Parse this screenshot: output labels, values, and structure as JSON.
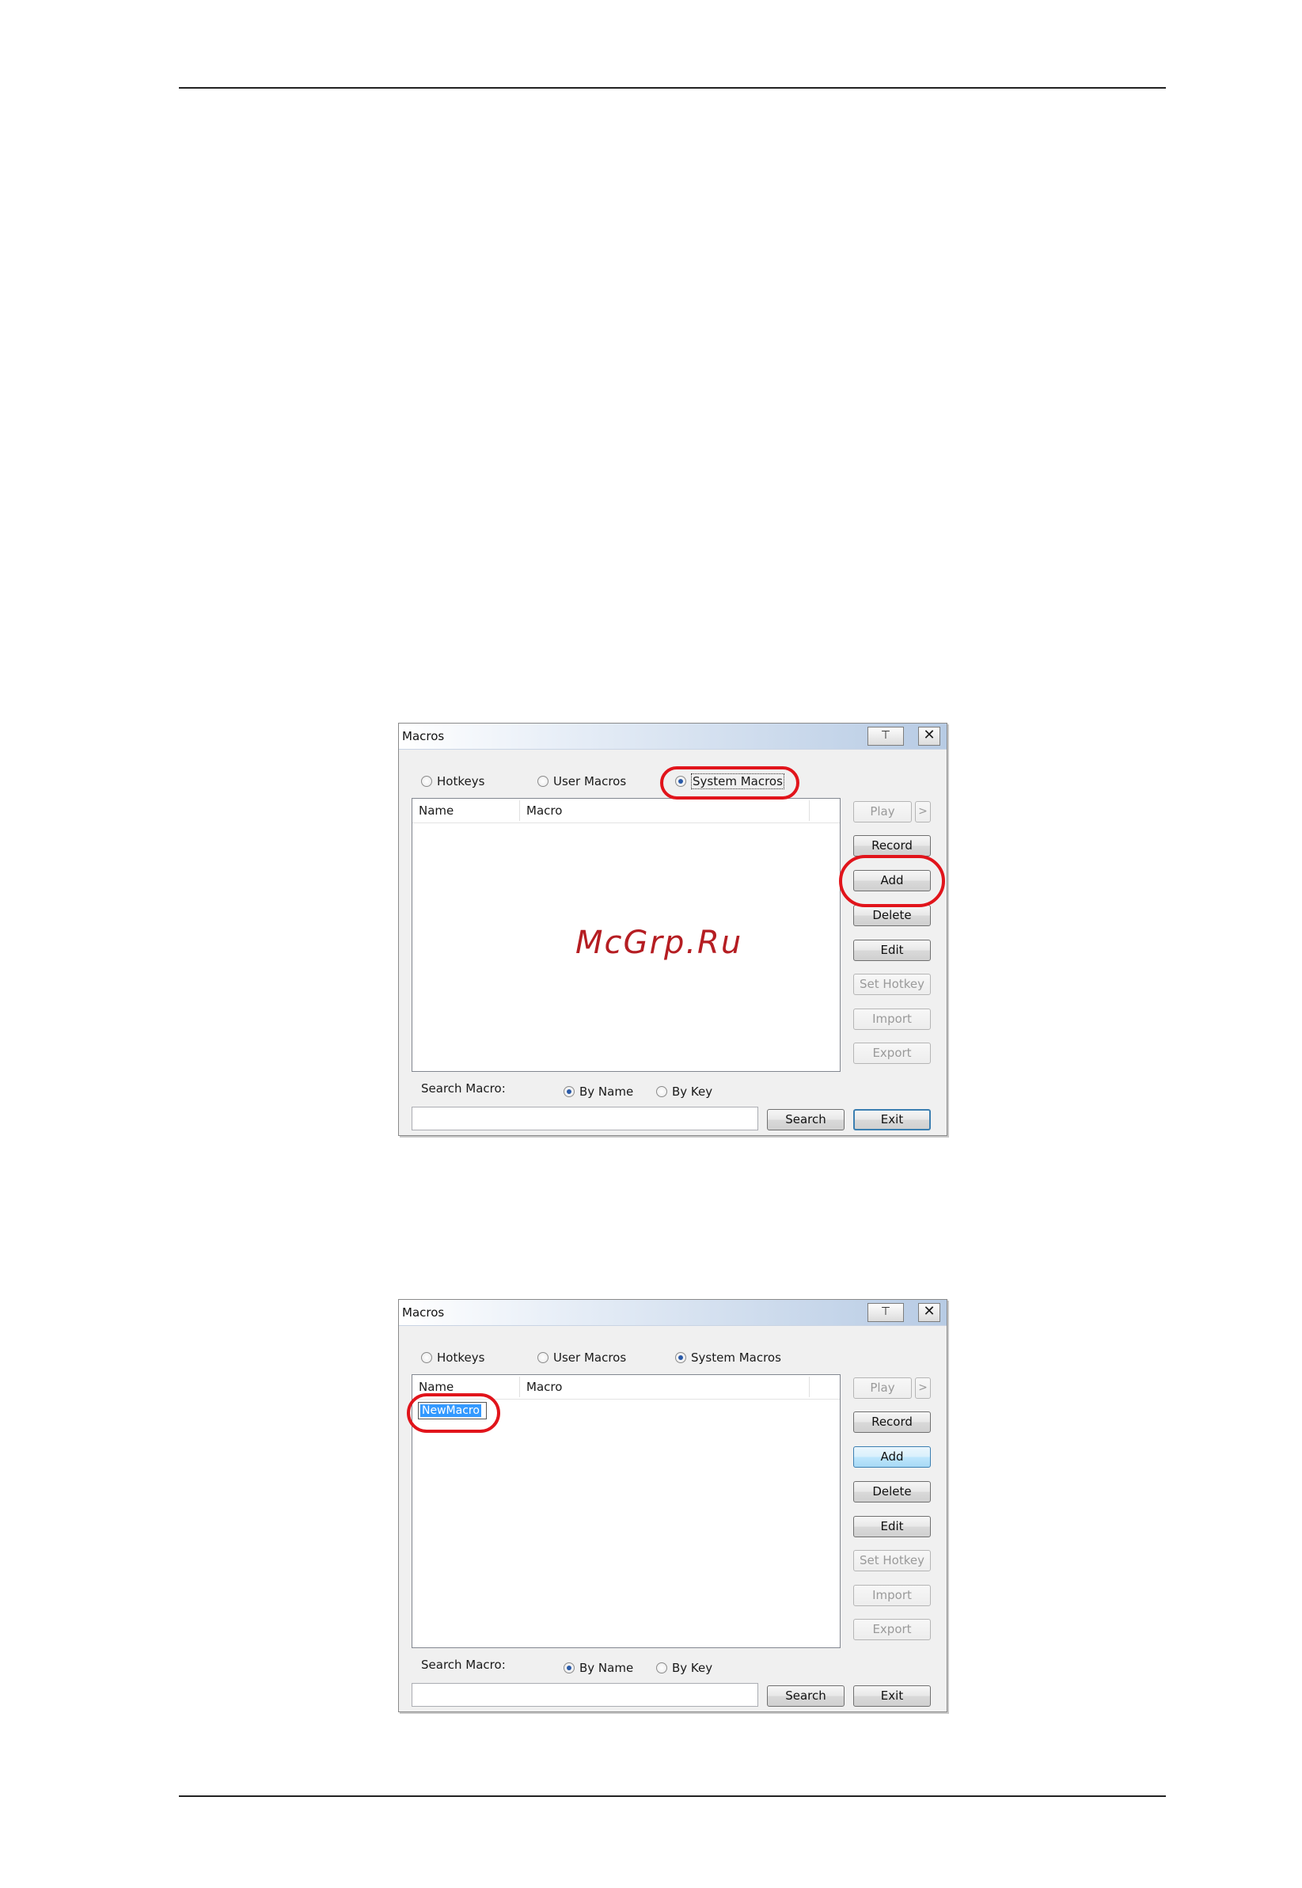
{
  "watermark": "McGrp.Ru",
  "dialogs": [
    {
      "title": "Macros",
      "pin_label": "⊤",
      "close_label": "✕",
      "radios": {
        "hotkeys": "Hotkeys",
        "user_macros": "User Macros",
        "system_macros": "System Macros",
        "selected": "System Macros"
      },
      "columns": [
        "Name",
        "Macro"
      ],
      "rows": [],
      "buttons": {
        "play": "Play",
        "next": ">",
        "record": "Record",
        "add": "Add",
        "delete": "Delete",
        "edit": "Edit",
        "set_hotkey": "Set Hotkey",
        "import": "Import",
        "export": "Export",
        "search": "Search",
        "exit": "Exit"
      },
      "search": {
        "label": "Search Macro:",
        "by_name": "By Name",
        "by_key": "By Key",
        "selected": "By Name",
        "value": ""
      }
    },
    {
      "title": "Macros",
      "pin_label": "⊤",
      "close_label": "✕",
      "radios": {
        "hotkeys": "Hotkeys",
        "user_macros": "User Macros",
        "system_macros": "System Macros",
        "selected": "System Macros"
      },
      "columns": [
        "Name",
        "Macro"
      ],
      "editing_cell_value": "NewMacro",
      "buttons": {
        "play": "Play",
        "next": ">",
        "record": "Record",
        "add": "Add",
        "delete": "Delete",
        "edit": "Edit",
        "set_hotkey": "Set Hotkey",
        "import": "Import",
        "export": "Export",
        "search": "Search",
        "exit": "Exit"
      },
      "search": {
        "label": "Search Macro:",
        "by_name": "By Name",
        "by_key": "By Key",
        "selected": "By Name",
        "value": ""
      }
    }
  ]
}
